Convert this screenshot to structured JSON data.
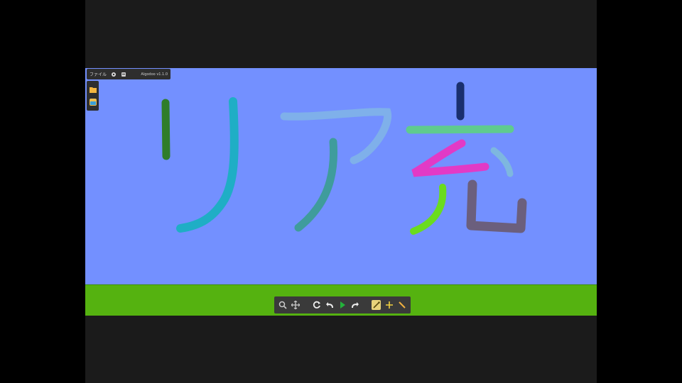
{
  "app": {
    "menu_label": "ファイル",
    "title": "Algodoo v1.1.0"
  },
  "colors": {
    "sky": "#7390ff",
    "ground": "#55b210",
    "letterbox": "#000000",
    "toolbar": "#3a3a3a"
  },
  "side_panel": {
    "items": [
      {
        "name": "folder-icon"
      },
      {
        "name": "scene-icon"
      }
    ]
  },
  "toolbar": {
    "tools": [
      {
        "name": "zoom-icon"
      },
      {
        "name": "move-icon"
      },
      {
        "name": "reset-icon"
      },
      {
        "name": "undo-icon"
      },
      {
        "name": "play-icon"
      },
      {
        "name": "redo-icon"
      },
      {
        "name": "sketch-tool-icon",
        "selected": true
      },
      {
        "name": "add-icon"
      },
      {
        "name": "brush-icon"
      }
    ]
  },
  "canvas": {
    "drawing": "リア充",
    "stroke_colors": [
      "#2f7d2a",
      "#1faec5",
      "#7fb0ea",
      "#3f9c9c",
      "#1a2f6e",
      "#5fcb8e",
      "#e23ac6",
      "#7eb7df",
      "#6adc1f",
      "#6b5f7d"
    ]
  }
}
